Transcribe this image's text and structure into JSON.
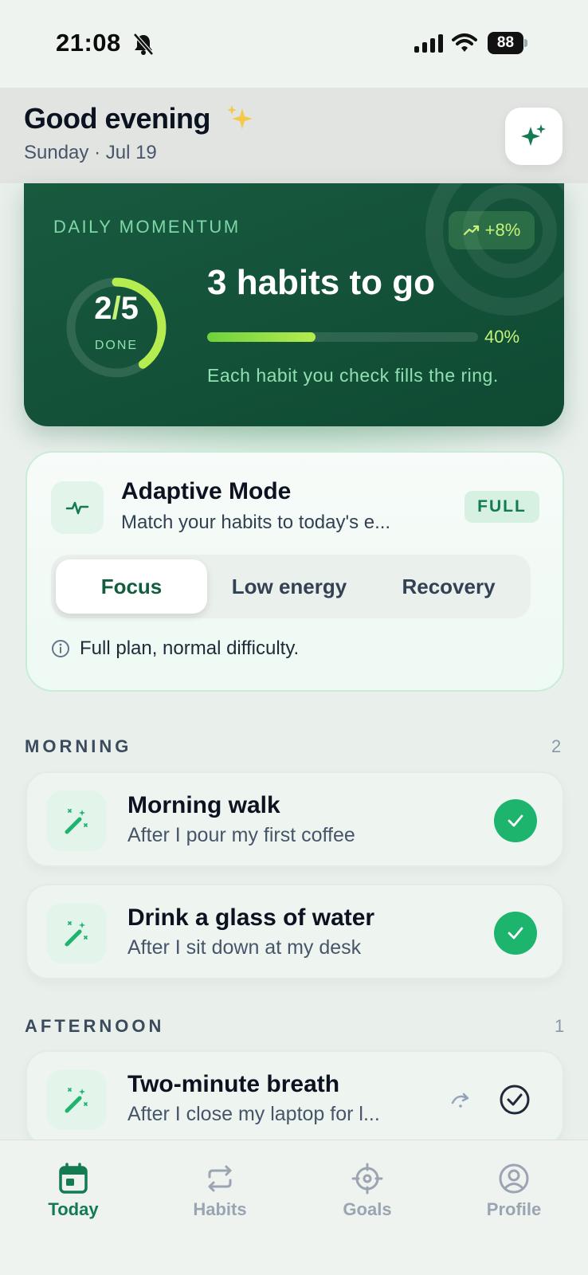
{
  "status_bar": {
    "time": "21:08",
    "battery": "88"
  },
  "header": {
    "greeting": "Good evening",
    "date": "Sunday · Jul 19"
  },
  "momentum": {
    "label": "DAILY MOMENTUM",
    "trend": "+8%",
    "done_count": "2",
    "total_count": "5",
    "slash": "/",
    "done_label": "DONE",
    "title": "3 habits to go",
    "progress_pct_text": "40%",
    "progress_fraction": 0.4,
    "hint": "Each habit you check fills the ring."
  },
  "adaptive": {
    "title": "Adaptive Mode",
    "subtitle": "Match your habits to today's e...",
    "badge": "FULL",
    "options": [
      "Focus",
      "Low energy",
      "Recovery"
    ],
    "selected": "Focus",
    "info": "Full plan, normal difficulty."
  },
  "sections": [
    {
      "label": "MORNING",
      "count": "2",
      "habits": [
        {
          "title": "Morning walk",
          "subtitle": "After I pour my first coffee",
          "done": true
        },
        {
          "title": "Drink a glass of water",
          "subtitle": "After I sit down at my desk",
          "done": true
        }
      ]
    },
    {
      "label": "AFTERNOON",
      "count": "1",
      "habits": [
        {
          "title": "Two-minute breath",
          "subtitle": "After I close my laptop for l...",
          "done": false
        }
      ]
    }
  ],
  "tabs": [
    {
      "label": "Today",
      "icon": "calendar-icon",
      "active": true
    },
    {
      "label": "Habits",
      "icon": "repeat-icon",
      "active": false
    },
    {
      "label": "Goals",
      "icon": "target-icon",
      "active": false
    },
    {
      "label": "Profile",
      "icon": "user-circle-icon",
      "active": false
    }
  ],
  "colors": {
    "brand": "#137a52",
    "card_dark": "#185a3f",
    "accent_lime": "#c6f27a",
    "check_green": "#1db46e"
  }
}
